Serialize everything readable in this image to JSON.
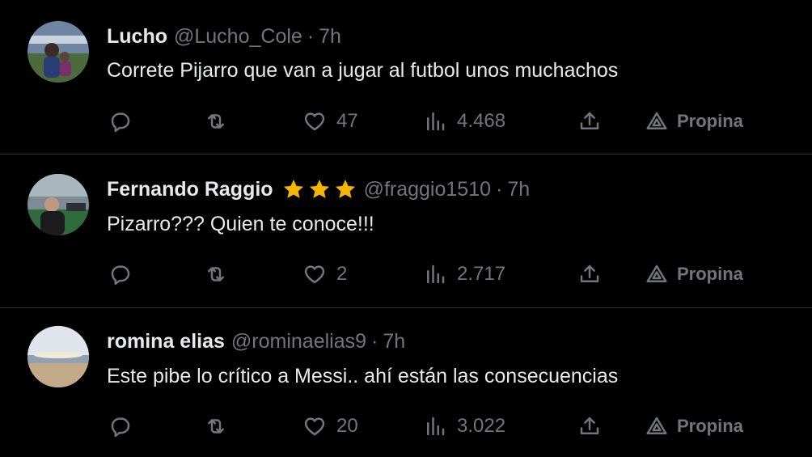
{
  "tweets": [
    {
      "name": "Lucho",
      "handle": "@Lucho_Cole",
      "separator": "·",
      "time": "7h",
      "text": "Correte Pijarro que van a jugar al futbol unos muchachos",
      "stars": 0,
      "replies": "",
      "retweets": "",
      "likes": "47",
      "views": "4.468",
      "tip_label": "Propina",
      "avatar_colors": [
        "#4a6a3a",
        "#7f8fa8",
        "#2d3e60"
      ]
    },
    {
      "name": "Fernando Raggio",
      "handle": "@fraggio1510",
      "separator": "·",
      "time": "7h",
      "text": "Pizarro??? Quien te conoce!!!",
      "stars": 3,
      "replies": "",
      "retweets": "",
      "likes": "2",
      "views": "2.717",
      "tip_label": "Propina",
      "avatar_colors": [
        "#3f4b42",
        "#8a9aa0",
        "#1d2320"
      ]
    },
    {
      "name": "romina elias",
      "handle": "@rominaelias9",
      "separator": "·",
      "time": "7h",
      "text": "Este pibe lo crítico a Messi..  ahí están las consecuencias",
      "stars": 0,
      "replies": "",
      "retweets": "",
      "likes": "20",
      "views": "3.022",
      "tip_label": "Propina",
      "avatar_colors": [
        "#c9d3dc",
        "#9aa8b0",
        "#6b5a45"
      ]
    }
  ],
  "colors": {
    "background": "#000000",
    "text": "#e7e9ea",
    "muted": "#71767b",
    "divider": "#2f3336",
    "star": "#f4b400"
  },
  "icons": {
    "reply": "reply-icon",
    "retweet": "retweet-icon",
    "like": "heart-icon",
    "views": "views-icon",
    "share": "share-icon",
    "tip": "tip-icon",
    "star": "star-icon"
  }
}
